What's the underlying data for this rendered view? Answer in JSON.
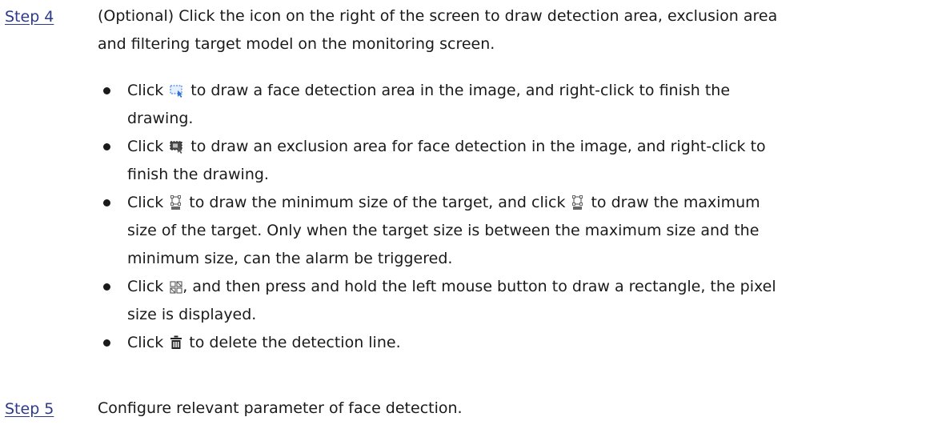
{
  "step4": {
    "label": "Step 4",
    "text_line1": "(Optional) Click the icon on the right of the screen to draw detection area, exclusion area",
    "text_line2": "and filtering target model on the monitoring screen."
  },
  "bullets": [
    {
      "click": "Click",
      "icon": "detection-area-icon",
      "line1_rest": "to draw a face detection area in the image, and right-click to finish the",
      "line2": "drawing."
    },
    {
      "click": "Click",
      "icon": "exclusion-area-icon",
      "line1_rest": "to draw an exclusion area for face detection in the image, and right-click to",
      "line2": "finish the drawing."
    },
    {
      "click": "Click",
      "icon": "min-size-icon",
      "line1_mid": "to draw the minimum size of the target, and click",
      "icon2": "max-size-icon",
      "line1_rest": "to draw the maximum",
      "line2": "size of the target. Only when the target size is between the maximum size and the",
      "line3": "minimum size, can the alarm be triggered."
    },
    {
      "click": "Click",
      "icon": "pixel-counter-icon",
      "line1_rest": ", and then press and hold the left mouse button to draw a rectangle, the pixel",
      "line2": "size is displayed."
    },
    {
      "click": "Click",
      "icon": "delete-icon",
      "line1_rest": "to delete the detection line."
    }
  ],
  "step5": {
    "label": "Step 5",
    "text": "Configure relevant parameter of face detection."
  },
  "colors": {
    "step_label": "#2d3a8c",
    "body_text": "#1a1a1a",
    "icon_blue": "#4a86e8"
  }
}
